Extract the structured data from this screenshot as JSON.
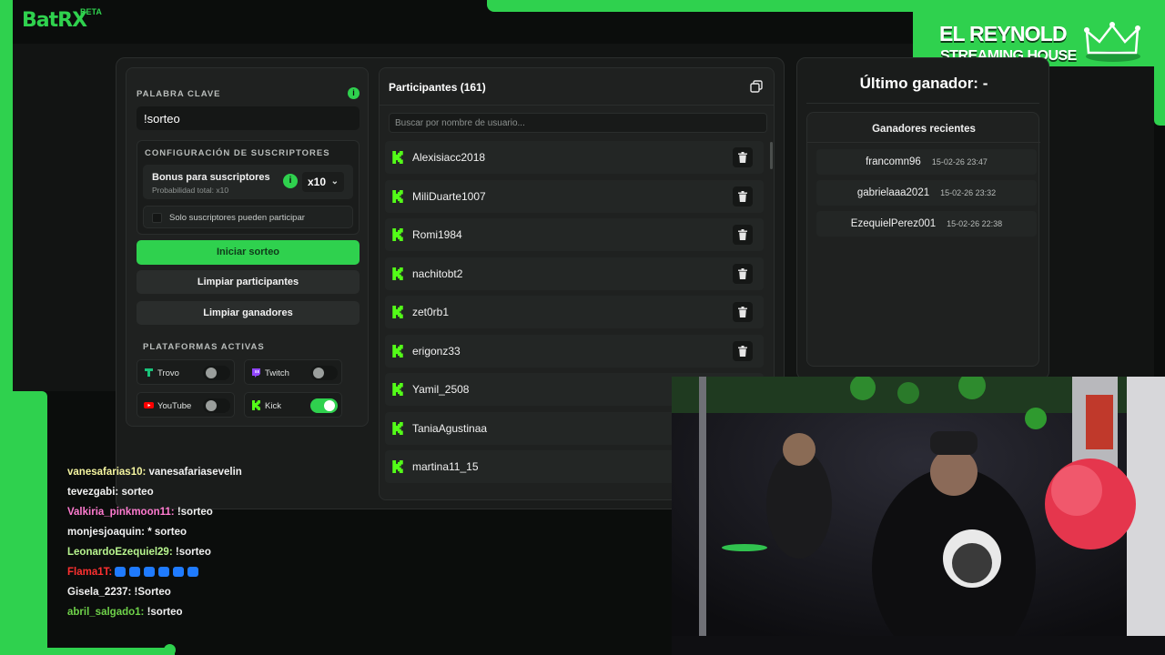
{
  "logo": {
    "text": "BatRX",
    "badge": "BETA"
  },
  "streamer": {
    "name": "EL REYNOLD",
    "subtitle": "STREAMING HOUSE"
  },
  "keyword": {
    "label": "PALABRA CLAVE",
    "value": "!sorteo",
    "info": "i"
  },
  "subscribers": {
    "label": "CONFIGURACIÓN DE SUSCRIPTORES",
    "bonus_title": "Bonus para suscriptores",
    "bonus_sub": "Probabilidad total: x10",
    "info": "i",
    "multiplier": "x10",
    "only_subs": "Solo suscriptores pueden participar"
  },
  "actions": {
    "start": "Iniciar sorteo",
    "clear_participants": "Limpiar participantes",
    "clear_winners": "Limpiar ganadores"
  },
  "platforms": {
    "label": "PLATAFORMAS ACTIVAS",
    "items": [
      {
        "name": "Trovo",
        "icon": "trovo-icon",
        "enabled": false,
        "color": "#19c37a"
      },
      {
        "name": "Twitch",
        "icon": "twitch-icon",
        "enabled": false,
        "color": "#9146ff"
      },
      {
        "name": "YouTube",
        "icon": "youtube-icon",
        "enabled": false,
        "color": "#ff0000"
      },
      {
        "name": "Kick",
        "icon": "kick-icon",
        "enabled": true,
        "color": "#53fc18"
      }
    ]
  },
  "participants": {
    "title": "Participantes (161)",
    "search_placeholder": "Buscar por nombre de usuario...",
    "list": [
      "Alexisiacc2018",
      "MiliDuarte1007",
      "Romi1984",
      "nachitobt2",
      "zet0rb1",
      "erigonz33",
      "Yamil_2508",
      "TaniaAgustinaa",
      "martina11_15"
    ]
  },
  "winners": {
    "last_winner": "Último ganador: -",
    "recent_title": "Ganadores recientes",
    "recent": [
      {
        "name": "francomn96",
        "date": "15-02-26 23:47"
      },
      {
        "name": "gabrielaaa2021",
        "date": "15-02-26 23:32"
      },
      {
        "name": "EzequielPerez001",
        "date": "15-02-26 22:38"
      }
    ]
  },
  "chat": [
    {
      "user": "vanesafarias10:",
      "msg": "vanesafariasevelin",
      "color": "#f5f5a0"
    },
    {
      "user": "tevezgabi:",
      "msg": "sorteo",
      "color": "#f1f1f1"
    },
    {
      "user": "Valkiria_pinkmoon11:",
      "msg": "!sorteo",
      "color": "#ff7bd0"
    },
    {
      "user": "monjesjoaquin:",
      "msg": "* sorteo",
      "color": "#f1f1f1"
    },
    {
      "user": "LeonardoEzequiel29:",
      "msg": "!sorteo",
      "color": "#b8f58f"
    },
    {
      "user": "Flama1T:",
      "msg": "",
      "color": "#ff3030"
    },
    {
      "user": "Gisela_2237:",
      "msg": "!Sorteo",
      "color": "#f1f1f1"
    },
    {
      "user": "abril_salgado1:",
      "msg": "!sorteo",
      "color": "#6fd24a"
    }
  ],
  "colors": {
    "accent": "#2fd14e",
    "panel": "#1f2120",
    "background": "#0b0d0c"
  }
}
